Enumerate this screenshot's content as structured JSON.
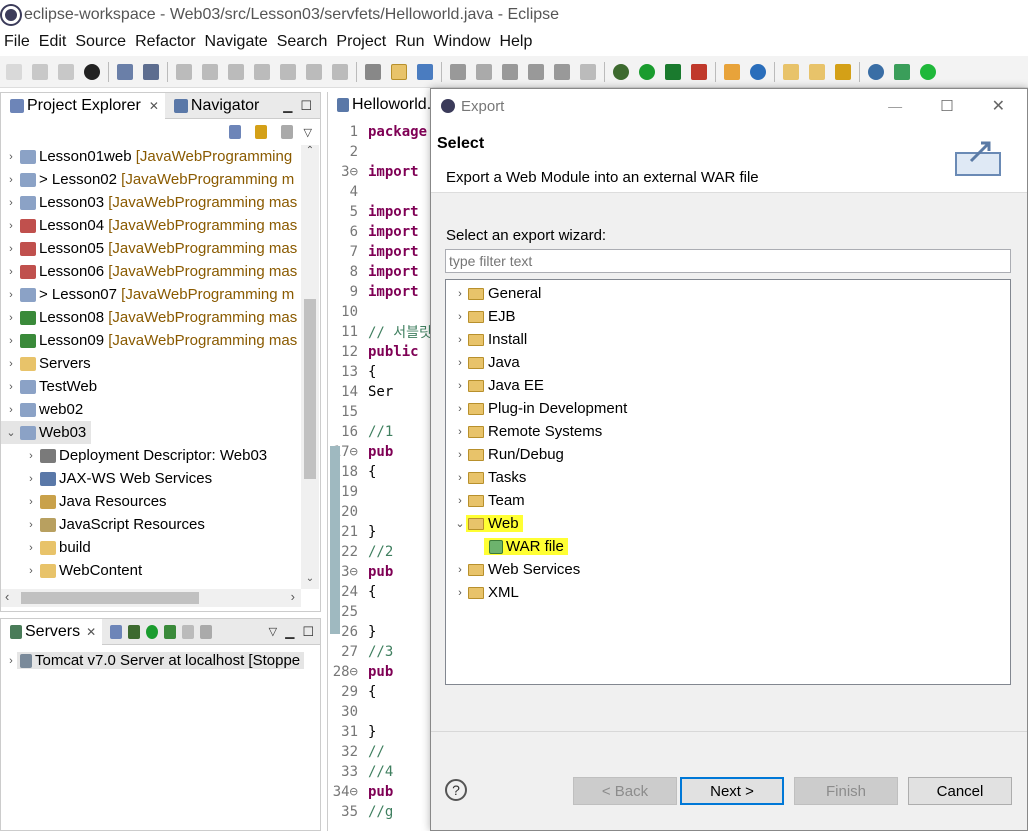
{
  "window": {
    "title": "eclipse-workspace - Web03/src/Lesson03/servfets/Helloworld.java - Eclipse"
  },
  "menu": [
    "File",
    "Edit",
    "Source",
    "Refactor",
    "Navigate",
    "Search",
    "Project",
    "Run",
    "Window",
    "Help"
  ],
  "project_explorer": {
    "tabs": {
      "explorer": "Project Explorer",
      "navigator": "Navigator"
    },
    "items": [
      {
        "name": "Lesson01web",
        "repo": "[JavaWebProgramming"
      },
      {
        "name": "> Lesson02",
        "repo": "[JavaWebProgramming m"
      },
      {
        "name": "Lesson03",
        "repo": "[JavaWebProgramming mas"
      },
      {
        "name": "Lesson04",
        "repo": "[JavaWebProgramming mas"
      },
      {
        "name": "Lesson05",
        "repo": "[JavaWebProgramming mas"
      },
      {
        "name": "Lesson06",
        "repo": "[JavaWebProgramming mas"
      },
      {
        "name": "> Lesson07",
        "repo": "[JavaWebProgramming m"
      },
      {
        "name": "Lesson08",
        "repo": "[JavaWebProgramming mas"
      },
      {
        "name": "Lesson09",
        "repo": "[JavaWebProgramming mas"
      },
      {
        "name": "Servers",
        "repo": ""
      },
      {
        "name": "TestWeb",
        "repo": ""
      },
      {
        "name": "web02",
        "repo": ""
      },
      {
        "name": "Web03",
        "repo": ""
      }
    ],
    "web03_children": [
      "Deployment Descriptor: Web03",
      "JAX-WS Web Services",
      "Java Resources",
      "JavaScript Resources",
      "build",
      "WebContent"
    ]
  },
  "servers_view": {
    "tab": "Servers",
    "entry": "Tomcat v7.0 Server at localhost  [Stoppe"
  },
  "editor": {
    "tab": "Helloworld.j",
    "lines": [
      {
        "n": "1",
        "t": "package"
      },
      {
        "n": "2",
        "t": ""
      },
      {
        "n": "3⊖",
        "t": "import"
      },
      {
        "n": "4",
        "t": ""
      },
      {
        "n": "5",
        "t": "import"
      },
      {
        "n": "6",
        "t": "import"
      },
      {
        "n": "7",
        "t": "import"
      },
      {
        "n": "8",
        "t": "import"
      },
      {
        "n": "9",
        "t": "import"
      },
      {
        "n": "10",
        "t": ""
      },
      {
        "n": "11",
        "t": "// 서블릿"
      },
      {
        "n": "12",
        "t": "public"
      },
      {
        "n": "13",
        "t": "{"
      },
      {
        "n": "14",
        "t": "    Ser"
      },
      {
        "n": "15",
        "t": ""
      },
      {
        "n": "16",
        "t": "    //1"
      },
      {
        "n": "17⊖",
        "t": "    pub"
      },
      {
        "n": "18",
        "t": "    {"
      },
      {
        "n": "19",
        "t": ""
      },
      {
        "n": "20",
        "t": ""
      },
      {
        "n": "21",
        "t": "    }"
      },
      {
        "n": "22",
        "t": "    //2"
      },
      {
        "n": "23⊖",
        "t": "    pub"
      },
      {
        "n": "24",
        "t": "    {"
      },
      {
        "n": "25",
        "t": ""
      },
      {
        "n": "26",
        "t": "    }"
      },
      {
        "n": "27",
        "t": "    //3"
      },
      {
        "n": "28⊖",
        "t": "    pub"
      },
      {
        "n": "29",
        "t": "    {"
      },
      {
        "n": "30",
        "t": ""
      },
      {
        "n": "31",
        "t": "    }"
      },
      {
        "n": "32",
        "t": "    //"
      },
      {
        "n": "33",
        "t": "    //4"
      },
      {
        "n": "34⊖",
        "t": "    pub"
      },
      {
        "n": "35",
        "t": "    //g"
      }
    ]
  },
  "dialog": {
    "title": "Export",
    "heading": "Select",
    "description": "Export a Web Module into an external WAR file",
    "wizard_label": "Select an export wizard:",
    "filter_placeholder": "type filter text",
    "categories": [
      "General",
      "EJB",
      "Install",
      "Java",
      "Java EE",
      "Plug-in Development",
      "Remote Systems",
      "Run/Debug",
      "Tasks",
      "Team",
      "Web",
      "Web Services",
      "XML"
    ],
    "web_child": "WAR file",
    "buttons": {
      "back": "< Back",
      "next": "Next >",
      "finish": "Finish",
      "cancel": "Cancel"
    },
    "help": "?"
  },
  "colors": {
    "highlight": "#ffff33",
    "repo_text": "#8a5a00",
    "keyword": "#7f0055",
    "primary_border": "#0078d7"
  }
}
